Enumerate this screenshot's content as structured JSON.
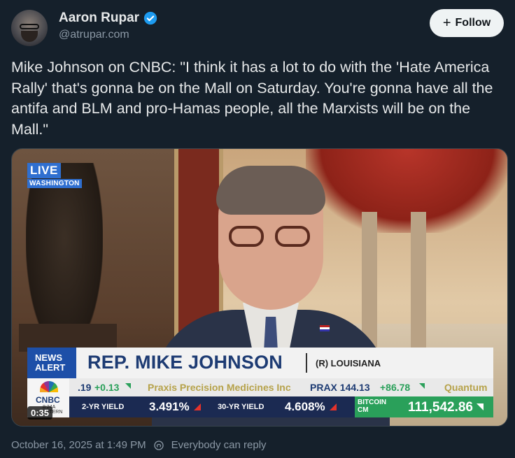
{
  "author": {
    "display_name": "Aaron Rupar",
    "handle": "@atrupar.com",
    "verified": true
  },
  "follow_button": {
    "label": "Follow",
    "icon": "plus-icon"
  },
  "tweet": {
    "text": "Mike Johnson on CNBC: \"I think it has a lot to do with the 'Hate America Rally' that's gonna be on the Mall on Saturday. You're gonna have all the antifa and BLM and pro-Hamas people, all the Marxists will be on the Mall.\""
  },
  "video": {
    "live_label": "LIVE",
    "location": "WASHINGTON",
    "news_alert": "NEWS ALERT",
    "news_alert_line1": "NEWS",
    "news_alert_line2": "ALERT",
    "name": "REP. MIKE JOHNSON",
    "state": "(R) LOUISIANA",
    "network": "CNBC",
    "network_sub_line1": "8:24A",
    "network_sub_line2": "ASTERN",
    "ticker_top": {
      "prefix": ".19",
      "change": "+0.13",
      "company": "Praxis Precision Medicines Inc",
      "symbol_price": "PRAX 144.13",
      "symbol_change": "+86.78",
      "next": "Quantum"
    },
    "ticker_bottom": {
      "yield2_label": "2-YR YIELD",
      "yield2_value": "3.491%",
      "yield30_label": "30-YR YIELD",
      "yield30_value": "4.608%",
      "btc_label_line1": "BITCOIN",
      "btc_label_line2": "CM",
      "btc_value": "111,542.86"
    },
    "timestamp": "0:35"
  },
  "footer": {
    "posted": "October 16, 2025 at 1:49 PM",
    "reply_setting": "Everybody can reply"
  },
  "colors": {
    "background": "#15202b",
    "verified_blue": "#1d9bf0",
    "cnbc_blue": "#1d4fa8",
    "ticker_green": "#2aa05a",
    "ticker_red": "#e4322b"
  }
}
